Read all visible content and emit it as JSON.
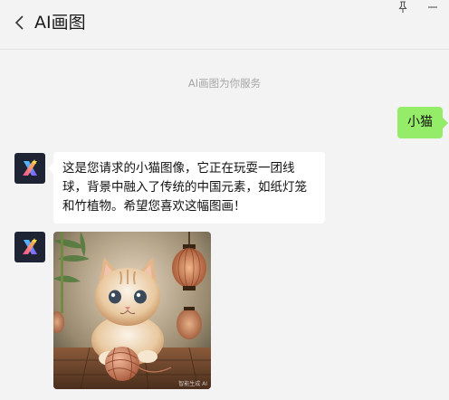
{
  "window": {
    "title": "AI画图"
  },
  "chat": {
    "service_notice": "AI画图为你服务",
    "user_message": "小猫",
    "bot_reply": "这是您请求的小猫图像，它正在玩耍一团线球，背景中融入了传统的中国元素，如纸灯笼和竹植物。希望您喜欢这幅图画！",
    "image_watermark": "智能生成 AI"
  },
  "colors": {
    "user_bubble": "#95ec69",
    "bot_bubble": "#ffffff",
    "avatar_bg": "#1e2433"
  },
  "icons": {
    "back": "chevron-left-icon",
    "pin": "pin-icon",
    "minimize": "minimize-icon",
    "bot_avatar": "ai-logo-icon"
  }
}
